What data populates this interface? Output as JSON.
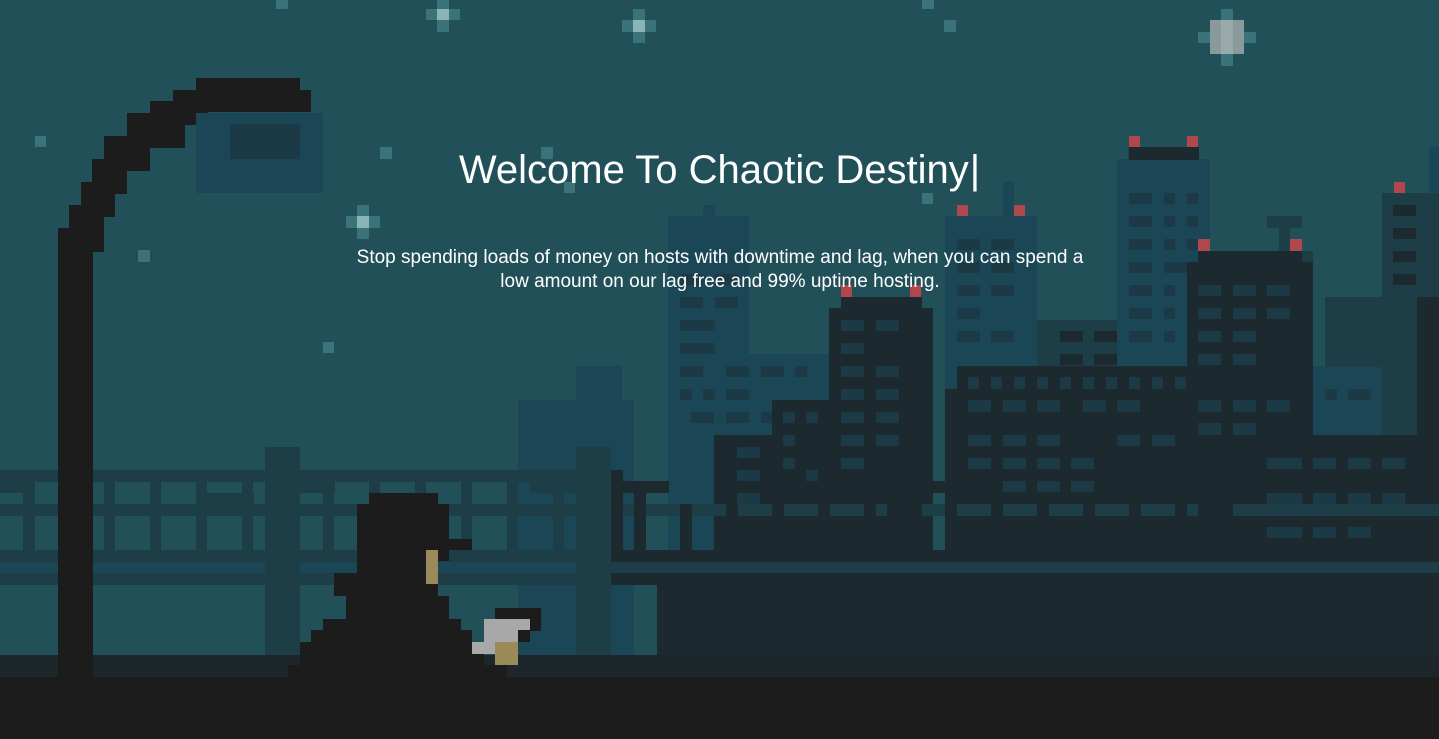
{
  "hero": {
    "title": "Welcome To Chaotic Destiny",
    "cursor": "|",
    "subtitle": "Stop spending loads of money on hosts with downtime and lag, when you can spend a low amount on our lag free and 99% uptime hosting."
  },
  "colors": {
    "sky": "#225059",
    "building_back": "#1b4655",
    "building_mid": "#1d3e47",
    "building_front": "#1c2a30",
    "silhouette": "#1c1c1c",
    "ground": "#1c262b",
    "antenna_light": "#b0474c",
    "star": "#8ab6b7",
    "text": "#ffffff"
  },
  "icons": {
    "street_lamp": "street-lamp-icon",
    "character": "hooded-figure-icon",
    "cat": "cat-icon"
  }
}
